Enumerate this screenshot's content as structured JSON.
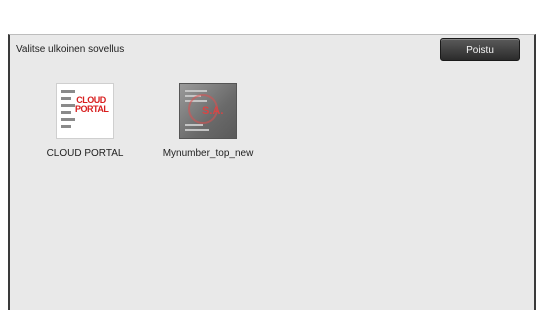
{
  "dialog": {
    "title": "Valitse ulkoinen sovellus",
    "exit_label": "Poistu"
  },
  "apps": [
    {
      "label": "CLOUD PORTAL",
      "icon": "cloud-portal-icon",
      "icon_text_line1": "CLOUD",
      "icon_text_line2": "PORTAL"
    },
    {
      "label": "Mynumber_top_new",
      "icon": "mynumber-icon"
    }
  ],
  "colors": {
    "panel_bg": "#e9e9e9",
    "button_bg": "#3a3a3a",
    "cloud_text": "#d81e1e"
  }
}
